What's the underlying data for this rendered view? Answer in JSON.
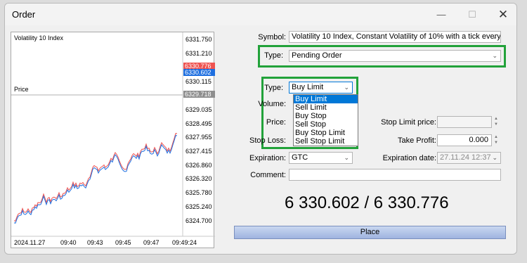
{
  "window": {
    "title": "Order",
    "min_glyph": "—",
    "max_glyph": "☐",
    "close_glyph": "✕"
  },
  "chart": {
    "symbol": "Volatility 10 Index",
    "price_label": "Price",
    "y_ticks": [
      "6331.750",
      "6331.210",
      "6330.115",
      "6329.035",
      "6328.495",
      "6327.955",
      "6327.415",
      "6326.860",
      "6326.320",
      "6325.780",
      "6325.240",
      "6324.700"
    ],
    "x_ticks": [
      "2024.11.27",
      "09:40",
      "09:43",
      "09:45",
      "09:47",
      "09:49:24"
    ],
    "ask_tag": "6330.776",
    "bid_tag": "6330.602",
    "line_tag": "6329.718",
    "ask_color": "#ef5350",
    "bid_color": "#1e6fe0"
  },
  "form": {
    "symbol_label": "Symbol:",
    "symbol_value": "Volatility 10 Index, Constant Volatility of 10% with a tick every",
    "type_label": "Type:",
    "type_value": "Pending Order",
    "subtype_label": "Type:",
    "subtype_value": "Buy Limit",
    "subtype_options": [
      "Buy Limit",
      "Sell Limit",
      "Buy Stop",
      "Sell Stop",
      "Buy Stop Limit",
      "Sell Stop Limit"
    ],
    "volume_label": "Volume:",
    "price_label": "Price:",
    "stop_loss_label": "Stop Loss:",
    "stop_limit_price_label": "Stop Limit price:",
    "take_profit_label": "Take Profit:",
    "take_profit_value": "0.000",
    "expiration_label": "Expiration:",
    "expiration_value": "GTC",
    "expiration_date_label": "Expiration date:",
    "expiration_date_value": "27.11.24 12:37",
    "comment_label": "Comment:",
    "comment_value": "",
    "quote": "6 330.602 / 6 330.776",
    "place_label": "Place",
    "highlight_color": "#22a23a"
  }
}
